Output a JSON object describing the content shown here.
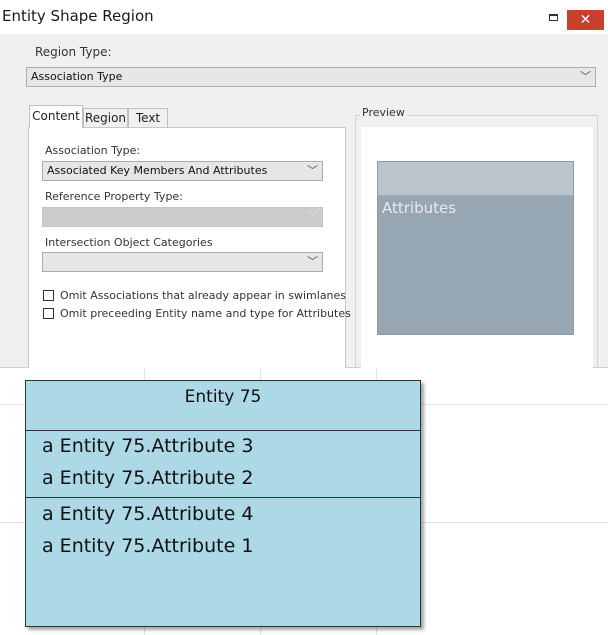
{
  "dialog": {
    "title": "Entity Shape Region",
    "close_glyph": "✕",
    "region_type_label": "Region Type:",
    "region_type_value": "Association Type",
    "tabs": [
      {
        "label": "Content",
        "active": true
      },
      {
        "label": "Region",
        "active": false
      },
      {
        "label": "Text",
        "active": false
      }
    ],
    "content": {
      "association_type_label": "Association Type:",
      "association_type_value": "Associated Key Members And Attributes",
      "reference_property_type_label": "Reference Property Type:",
      "reference_property_type_value": "",
      "intersection_label": "Intersection Object Categories",
      "intersection_value": "",
      "checkboxes": [
        {
          "label": "Omit Associations that already appear in swimlanes",
          "checked": false
        },
        {
          "label": "Omit preceeding Entity name and type for Attributes",
          "checked": false
        }
      ]
    },
    "preview": {
      "label": "Preview",
      "attribute_text": "Attributes"
    },
    "colors": {
      "close_button": "#c7402c",
      "preview_body": "#97a6b3",
      "preview_header": "#b9c4cd"
    }
  },
  "diagram": {
    "entity_name": "Entity 75",
    "key_attributes": [
      "a Entity 75.Attribute 3",
      "a Entity 75.Attribute 2"
    ],
    "other_attributes": [
      "a Entity 75.Attribute 4",
      "a Entity 75.Attribute 1"
    ],
    "colors": {
      "entity_fill": "#add8e6",
      "entity_border": "#333333"
    }
  },
  "icons": {
    "dropdown": "chevron-down-icon",
    "maximize": "maximize-icon",
    "close": "close-icon"
  }
}
